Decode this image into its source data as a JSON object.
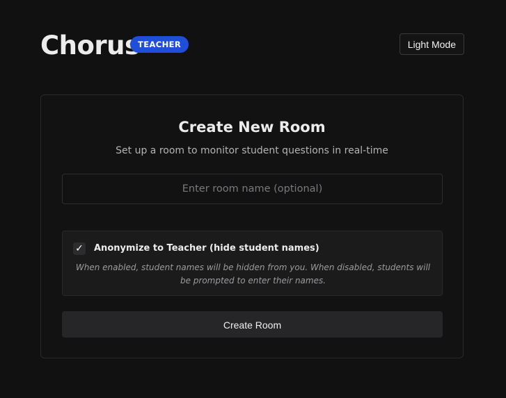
{
  "header": {
    "brand": "Chorus",
    "role_badge": "TEACHER",
    "theme_toggle_label": "Light Mode"
  },
  "create_room": {
    "title": "Create New Room",
    "subtitle": "Set up a room to monitor student questions in real-time",
    "room_name": {
      "value": "",
      "placeholder": "Enter room name (optional)"
    },
    "anonymize": {
      "checked": true,
      "check_glyph": "✓",
      "label": "Anonymize to Teacher (hide student names)",
      "description": "When enabled, student names will be hidden from you. When disabled, students will be prompted to enter their names."
    },
    "submit_label": "Create Room"
  },
  "colors": {
    "background": "#111112",
    "badge": "#1f4fd8",
    "card_border": "#2a2a2d",
    "button": "#262628"
  }
}
